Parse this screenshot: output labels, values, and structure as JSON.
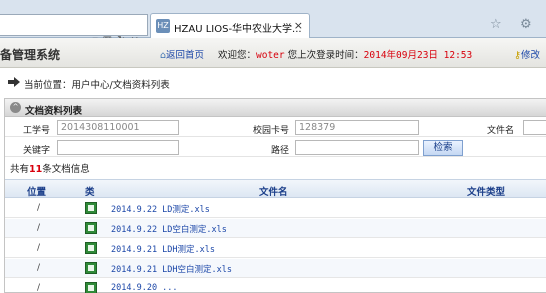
{
  "browser": {
    "tab_title": "HZAU LIOS-华中农业大学...",
    "tab_close": "×",
    "tab_favicon": "HZ"
  },
  "header": {
    "system_title": "备管理系统",
    "home_link": "返回首页",
    "welcome_prefix": "欢迎您：",
    "user": "woter",
    "last_login_label": "您上次登录时间：",
    "last_login_time": "2014年09月23日  12:53",
    "modify_link": "修改"
  },
  "breadcrumb": {
    "text": "当前位置：用户中心/文档资料列表"
  },
  "panel": {
    "title": "文档资料列表"
  },
  "filters": {
    "employee_no_label": "工学号",
    "employee_no_value": "2014308110001",
    "campus_card_label": "校园卡号",
    "campus_card_value": "128379",
    "filename_label": "文件名",
    "keyword_label": "关键字",
    "path_label": "路径",
    "search_button": "检索"
  },
  "summary": {
    "prefix": "共有",
    "count": "11",
    "suffix": "条文档信息"
  },
  "table": {
    "headers": {
      "position": "位置",
      "type": "类",
      "filename": "文件名",
      "filetype": "文件类型"
    },
    "rows": [
      {
        "position": "/",
        "name": "2014.9.22 LD测定.xls"
      },
      {
        "position": "/",
        "name": "2014.9.22 LD空白测定.xls"
      },
      {
        "position": "/",
        "name": "2014.9.21 LDH测定.xls"
      },
      {
        "position": "/",
        "name": "2014.9.21 LDH空白测定.xls"
      },
      {
        "position": "/",
        "name": "2014.9.20 ..."
      }
    ]
  }
}
